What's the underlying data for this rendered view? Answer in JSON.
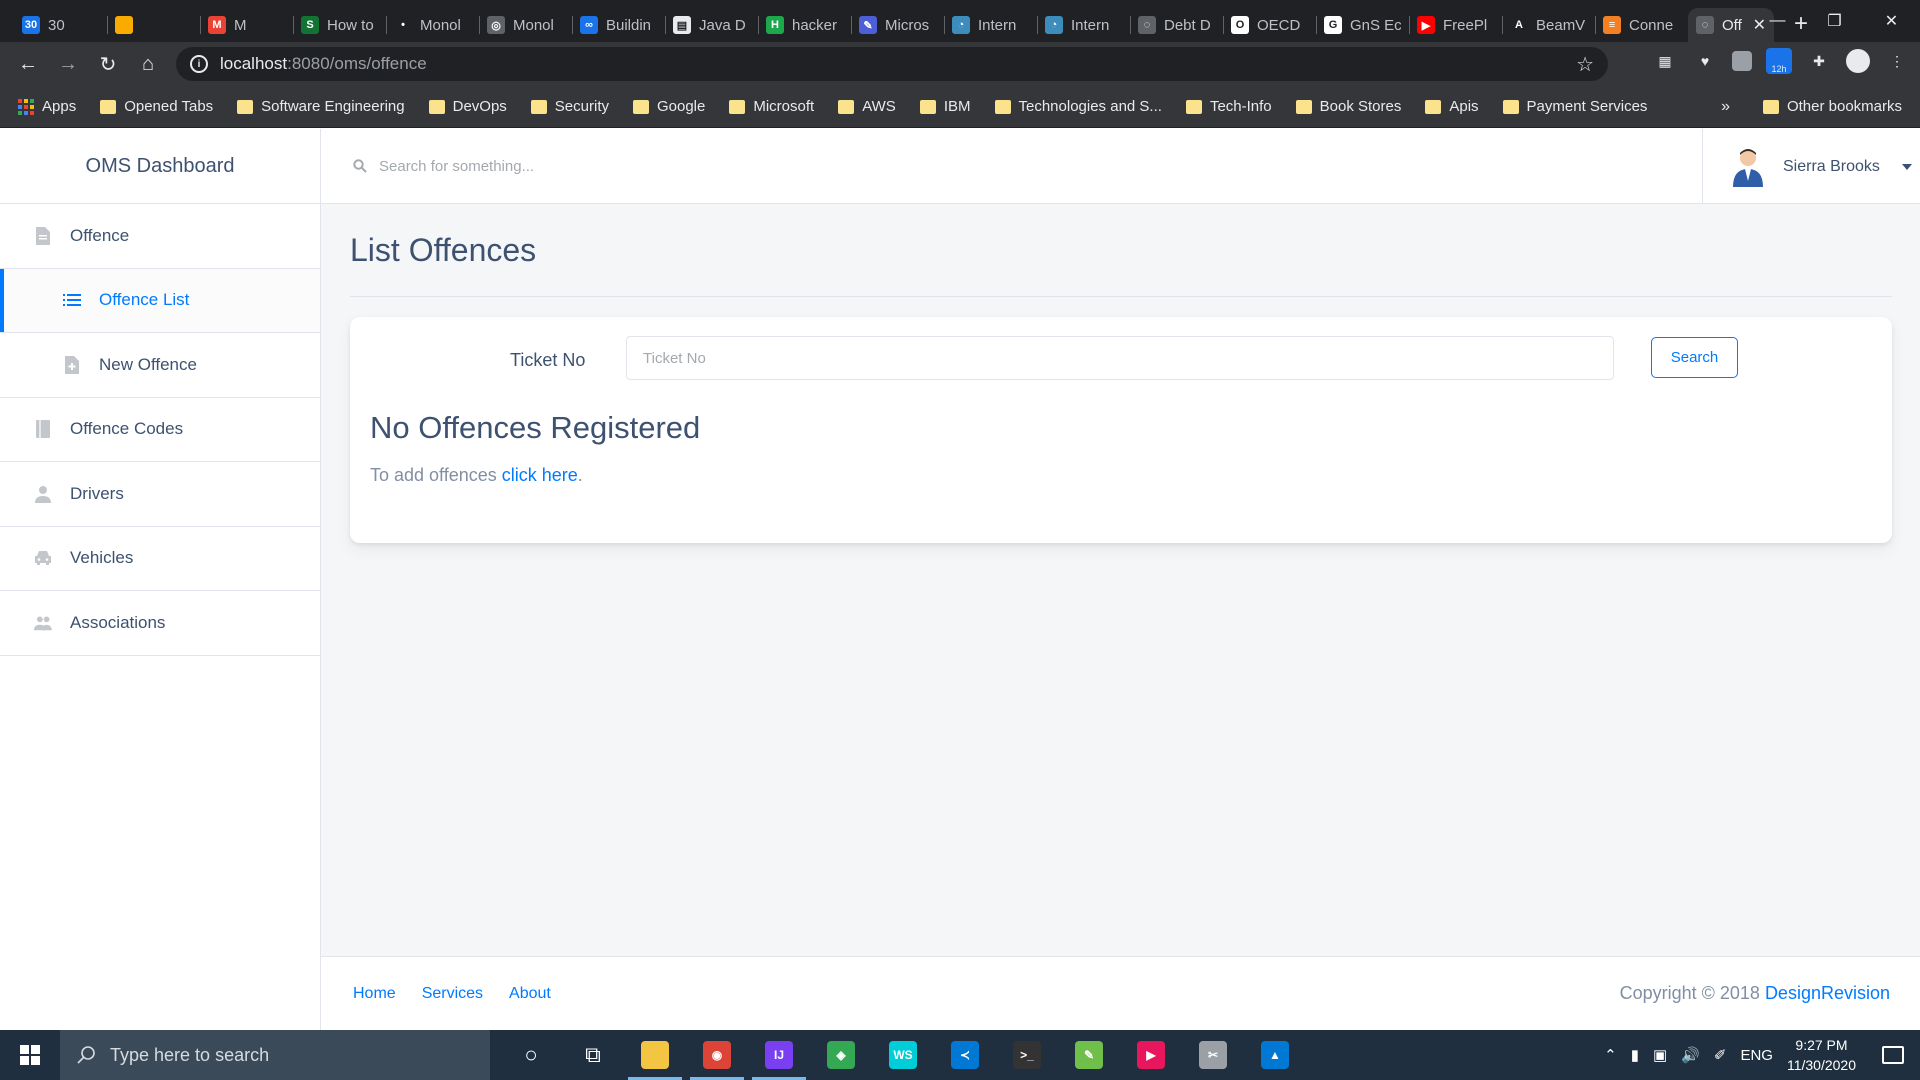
{
  "browser": {
    "tabs": [
      {
        "label": "30",
        "color": "#1a73e8",
        "text": "30"
      },
      {
        "label": "",
        "color": "#f9ab00",
        "text": ""
      },
      {
        "label": "M",
        "color": "#ea4335",
        "text": "M"
      },
      {
        "label": "How to",
        "color": "#137333",
        "text": "S"
      },
      {
        "label": "Monol",
        "color": "#202124",
        "text": "•"
      },
      {
        "label": "Monol",
        "color": "#5f6368",
        "text": "◎"
      },
      {
        "label": "Buildin",
        "color": "#1a73e8",
        "text": "∞"
      },
      {
        "label": "Java D",
        "color": "#e8eaed",
        "text": "▤"
      },
      {
        "label": "hacker",
        "color": "#1ba94c",
        "text": "H"
      },
      {
        "label": "Micros",
        "color": "#4c5fd7",
        "text": "✎"
      },
      {
        "label": "Intern",
        "color": "#3c8dbc",
        "text": "◔"
      },
      {
        "label": "Intern",
        "color": "#3c8dbc",
        "text": "◔"
      },
      {
        "label": "Debt D",
        "color": "#5f6368",
        "text": "◌"
      },
      {
        "label": "OECD",
        "color": "#ffffff",
        "text": "O"
      },
      {
        "label": "GnS Ec",
        "color": "#ffffff",
        "text": "G"
      },
      {
        "label": "FreePl",
        "color": "#ff0000",
        "text": "▶"
      },
      {
        "label": "BeamV",
        "color": "#202124",
        "text": "A"
      },
      {
        "label": "Conne",
        "color": "#f48024",
        "text": "≡"
      }
    ],
    "active_tab": {
      "label": "Off",
      "close": "✕"
    },
    "new_tab": "+",
    "window_controls": {
      "minimize": "—",
      "restore": "❐",
      "close": "✕"
    },
    "url": {
      "host": "localhost",
      "path": ":8080/oms/offence"
    },
    "bookmarks": [
      {
        "label": "Apps",
        "type": "apps"
      },
      {
        "label": "Opened Tabs",
        "type": "folder"
      },
      {
        "label": "Software Engineering",
        "type": "folder"
      },
      {
        "label": "DevOps",
        "type": "folder"
      },
      {
        "label": "Security",
        "type": "folder"
      },
      {
        "label": "Google",
        "type": "folder"
      },
      {
        "label": "Microsoft",
        "type": "folder"
      },
      {
        "label": "AWS",
        "type": "folder"
      },
      {
        "label": "IBM",
        "type": "folder"
      },
      {
        "label": "Technologies and S...",
        "type": "folder"
      },
      {
        "label": "Tech-Info",
        "type": "folder"
      },
      {
        "label": "Book Stores",
        "type": "folder"
      },
      {
        "label": "Apis",
        "type": "folder"
      },
      {
        "label": "Payment Services",
        "type": "folder"
      }
    ],
    "bookmarks_more": "»",
    "other_bookmarks": "Other bookmarks",
    "extension_badge": "12h"
  },
  "app": {
    "brand": "OMS Dashboard",
    "nav": [
      {
        "label": "Offence",
        "icon": "file-icon",
        "sub": false,
        "active": false
      },
      {
        "label": "Offence List",
        "icon": "list-icon",
        "sub": true,
        "active": true
      },
      {
        "label": "New Offence",
        "icon": "file-plus-icon",
        "sub": true,
        "active": false
      },
      {
        "label": "Offence Codes",
        "icon": "book-icon",
        "sub": false,
        "active": false
      },
      {
        "label": "Drivers",
        "icon": "person-icon",
        "sub": false,
        "active": false
      },
      {
        "label": "Vehicles",
        "icon": "car-icon",
        "sub": false,
        "active": false
      },
      {
        "label": "Associations",
        "icon": "people-icon",
        "sub": false,
        "active": false
      }
    ],
    "search_placeholder": "Search for something...",
    "user_name": "Sierra Brooks",
    "page_title": "List Offences",
    "ticket_label": "Ticket No",
    "ticket_placeholder": "Ticket No",
    "search_button": "Search",
    "empty_title": "No Offences Registered",
    "empty_text": "To add offences ",
    "empty_link": "click here",
    "empty_end": ".",
    "footer_links": [
      "Home",
      "Services",
      "About"
    ],
    "copyright": "Copyright © 2018 ",
    "copyright_brand": "DesignRevision",
    "accent_color": "#007bff"
  },
  "taskbar": {
    "search_placeholder": "Type here to search",
    "apps": [
      {
        "name": "cortana-icon",
        "color": "transparent",
        "text": "○",
        "active": false
      },
      {
        "name": "task-view-icon",
        "color": "transparent",
        "text": "⧉",
        "active": false
      },
      {
        "name": "file-explorer-icon",
        "color": "#f4c542",
        "text": "",
        "active": true
      },
      {
        "name": "chrome-icon",
        "color": "#db4437",
        "text": "◉",
        "active": true
      },
      {
        "name": "intellij-icon",
        "color": "#7b3ff2",
        "text": "IJ",
        "active": true
      },
      {
        "name": "maps-icon",
        "color": "#34a853",
        "text": "◈",
        "active": false
      },
      {
        "name": "webstorm-icon",
        "color": "#00cdd7",
        "text": "WS",
        "active": false
      },
      {
        "name": "vscode-icon",
        "color": "#0078d4",
        "text": "≺",
        "active": false
      },
      {
        "name": "terminal-icon",
        "color": "#333333",
        "text": ">_",
        "active": false
      },
      {
        "name": "notepad-icon",
        "color": "#6fbf4a",
        "text": "✎",
        "active": false
      },
      {
        "name": "media-player-icon",
        "color": "#e8175d",
        "text": "▶",
        "active": false
      },
      {
        "name": "snipping-icon",
        "color": "#9aa0a6",
        "text": "✂",
        "active": false
      },
      {
        "name": "photos-icon",
        "color": "#0078d4",
        "text": "▲",
        "active": false
      }
    ],
    "language": "ENG",
    "time": "9:27 PM",
    "date": "11/30/2020"
  }
}
